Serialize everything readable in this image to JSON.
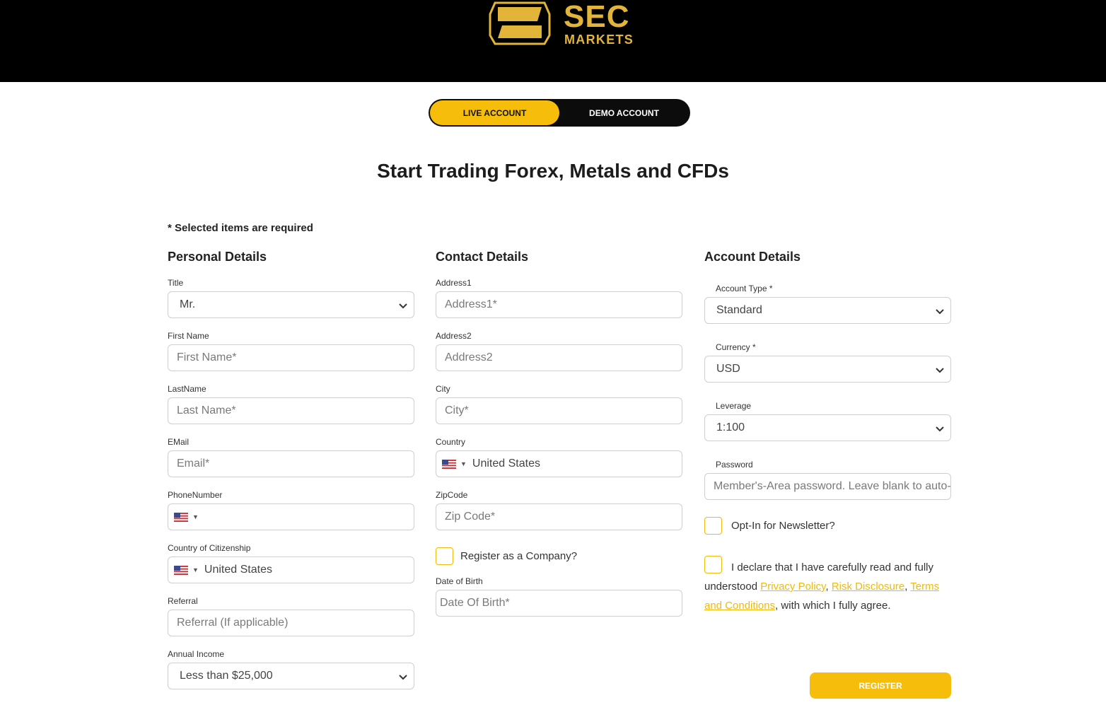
{
  "brand": {
    "name_line1": "SEC",
    "name_line2": "MARKETS",
    "gold": "#e2b53a",
    "accent": "#f6bd0b"
  },
  "account_toggle": {
    "live_label": "LIVE ACCOUNT",
    "demo_label": "DEMO ACCOUNT",
    "selected": "LIVE ACCOUNT"
  },
  "page_title": "Start Trading Forex, Metals and CFDs",
  "required_note": "* Selected items are required",
  "personal": {
    "heading": "Personal Details",
    "title_label": "Title",
    "title_value": "Mr.",
    "first_name_label": "First Name",
    "first_name_placeholder": "First Name*",
    "last_name_label": "LastName",
    "last_name_placeholder": "Last Name*",
    "email_label": "EMail",
    "email_placeholder": "Email*",
    "phone_label": "PhoneNumber",
    "phone_country_icon": "us-flag-icon",
    "citizenship_label": "Country of Citizenship",
    "citizenship_value": "United States",
    "referral_label": "Referral",
    "referral_placeholder": "Referral (If applicable)",
    "income_label": "Annual Income",
    "income_value": "Less than $25,000"
  },
  "contact": {
    "heading": "Contact Details",
    "address1_label": "Address1",
    "address1_placeholder": "Address1*",
    "address2_label": "Address2",
    "address2_placeholder": "Address2",
    "city_label": "City",
    "city_placeholder": "City*",
    "country_label": "Country",
    "country_value": "United States",
    "zip_label": "ZipCode",
    "zip_placeholder": "Zip Code*",
    "company_checkbox_label": "Register as a Company?",
    "dob_label": "Date of Birth",
    "dob_placeholder": "Date Of Birth*"
  },
  "account": {
    "heading": "Account Details",
    "account_type_label": "Account Type *",
    "account_type_value": "Standard",
    "currency_label": "Currency *",
    "currency_value": "USD",
    "leverage_label": "Leverage",
    "leverage_value": "1:100",
    "password_label": "Password",
    "password_placeholder": "Member's-Area password. Leave blank to auto-generate",
    "newsletter_label": "Opt-In for Newsletter?",
    "declare_text_1": "I declare that I have carefully read and fully understood",
    "privacy_link": "Privacy Policy",
    "comma_1": ",",
    "risk_link": "Risk Disclosure",
    "comma_2": ",",
    "terms_link": "Terms and Conditions",
    "declare_text_2": ", with which I fully agree."
  },
  "register_label": "REGISTER"
}
